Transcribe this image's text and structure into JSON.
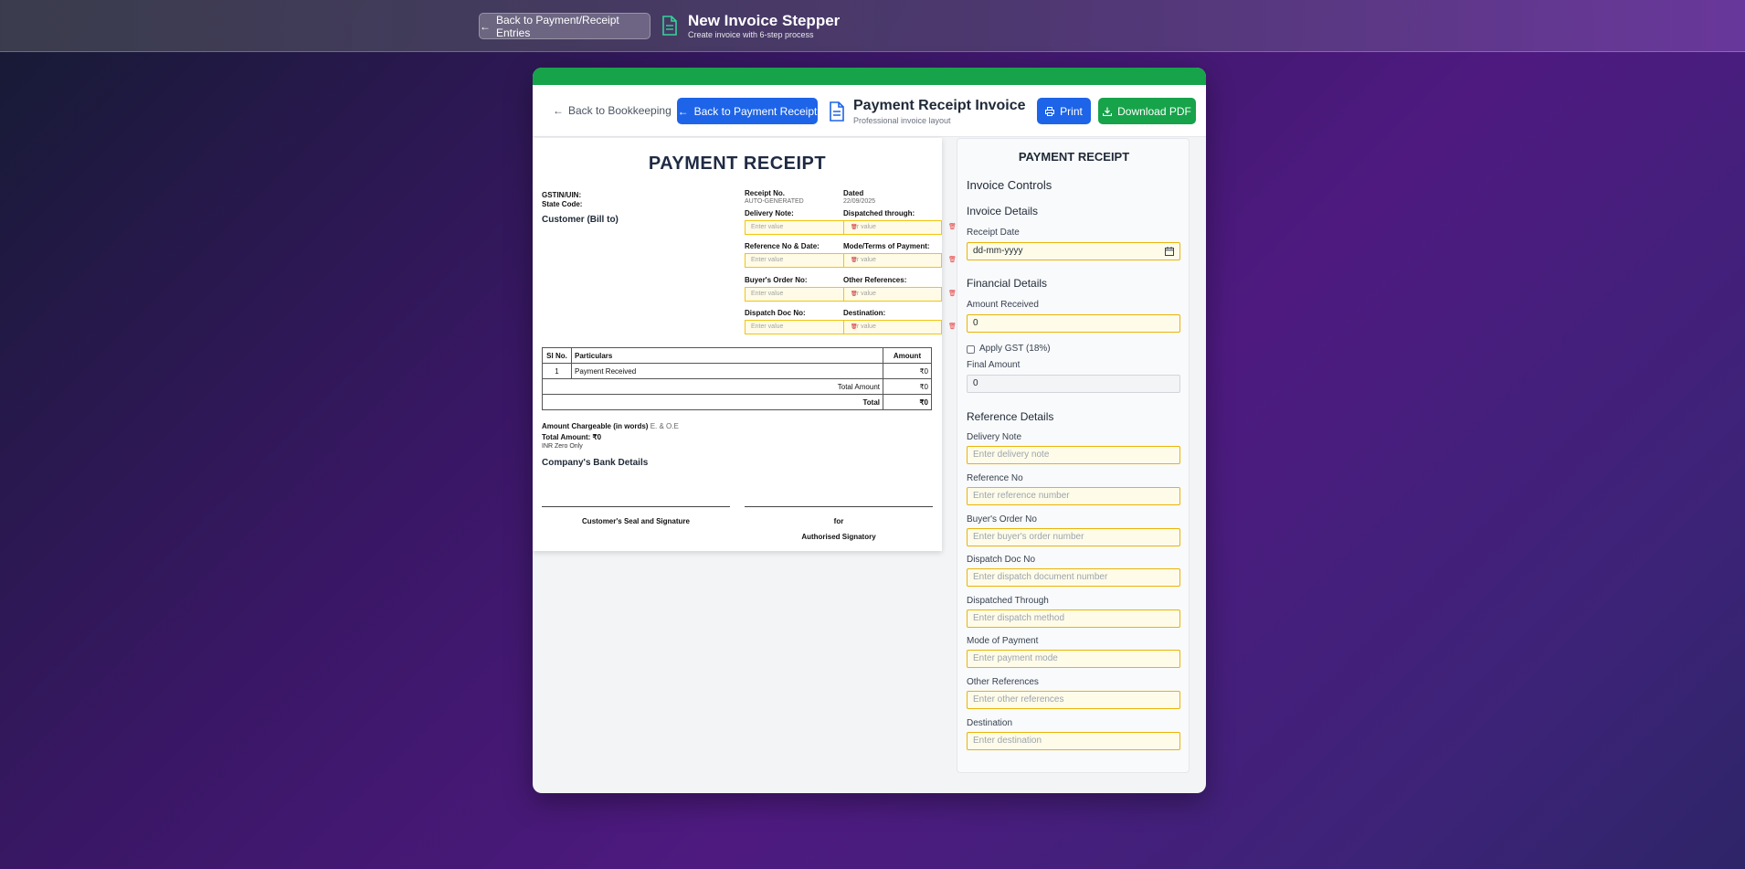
{
  "topbar": {
    "back_label": "Back to Payment/Receipt Entries",
    "title": "New Invoice Stepper",
    "subtitle": "Create invoice with 6-step process"
  },
  "header": {
    "back_bookkeeping": "Back to Bookkeeping",
    "back_payment_receipt": "Back to Payment Receipt",
    "title": "Payment Receipt Invoice",
    "subtitle": "Professional invoice layout",
    "print_label": "Print",
    "download_label": "Download PDF"
  },
  "invoice": {
    "title": "PAYMENT RECEIPT",
    "gstin_label": "GSTIN/UIN:",
    "state_code_label": "State Code:",
    "customer_label": "Customer (Bill to)",
    "receipt_no_label": "Receipt No.",
    "receipt_no_value": "AUTO-GENERATED",
    "dated_label": "Dated",
    "dated_value": "22/09/2025",
    "fields": {
      "delivery_note": "Delivery Note:",
      "dispatched_through": "Dispatched through:",
      "reference_no_date": "Reference No & Date:",
      "mode_terms_payment": "Mode/Terms of Payment:",
      "buyers_order_no": "Buyer's Order No:",
      "other_references": "Other References:",
      "dispatch_doc_no": "Dispatch Doc No:",
      "destination": "Destination:"
    },
    "field_placeholder": "Enter value",
    "field_placeholder_clipped": "ter value",
    "table": {
      "headers": {
        "sl": "Sl No.",
        "particulars": "Particulars",
        "amount": "Amount"
      },
      "rows": [
        {
          "sl": "1",
          "particulars": "Payment Received",
          "amount": "₹0"
        }
      ],
      "total_amount_label": "Total Amount",
      "total_amount_value": "₹0",
      "total_label": "Total",
      "total_value": "₹0"
    },
    "amount_words_label": "Amount Chargeable (in words)",
    "amount_words_suffix": "E. & O.E",
    "total_amount_line": "Total Amount: ₹0",
    "words_value": "INR Zero Only",
    "bank_details_label": "Company's Bank Details",
    "customer_signature": "Customer's Seal and Signature",
    "for_label": "for",
    "authorised_signatory": "Authorised Signatory"
  },
  "controls": {
    "heading": "PAYMENT RECEIPT",
    "section_controls": "Invoice Controls",
    "section_details": "Invoice Details",
    "receipt_date_label": "Receipt Date",
    "receipt_date_value": "dd-mm-yyyy",
    "section_financial": "Financial Details",
    "amount_received_label": "Amount Received",
    "amount_received_value": "0",
    "apply_gst_label": "Apply GST (18%)",
    "final_amount_label": "Final Amount",
    "final_amount_value": "0",
    "section_reference": "Reference Details",
    "ref_fields": [
      {
        "label": "Delivery Note",
        "placeholder": "Enter delivery note"
      },
      {
        "label": "Reference No",
        "placeholder": "Enter reference number"
      },
      {
        "label": "Buyer's Order No",
        "placeholder": "Enter buyer's order number"
      },
      {
        "label": "Dispatch Doc No",
        "placeholder": "Enter dispatch document number"
      },
      {
        "label": "Dispatched Through",
        "placeholder": "Enter dispatch method"
      },
      {
        "label": "Mode of Payment",
        "placeholder": "Enter payment mode"
      },
      {
        "label": "Other References",
        "placeholder": "Enter other references"
      },
      {
        "label": "Destination",
        "placeholder": "Enter destination"
      }
    ]
  },
  "colors": {
    "accent_green": "#16a34a",
    "primary_blue": "#1d64e8",
    "input_border_yellow": "#eab308"
  }
}
